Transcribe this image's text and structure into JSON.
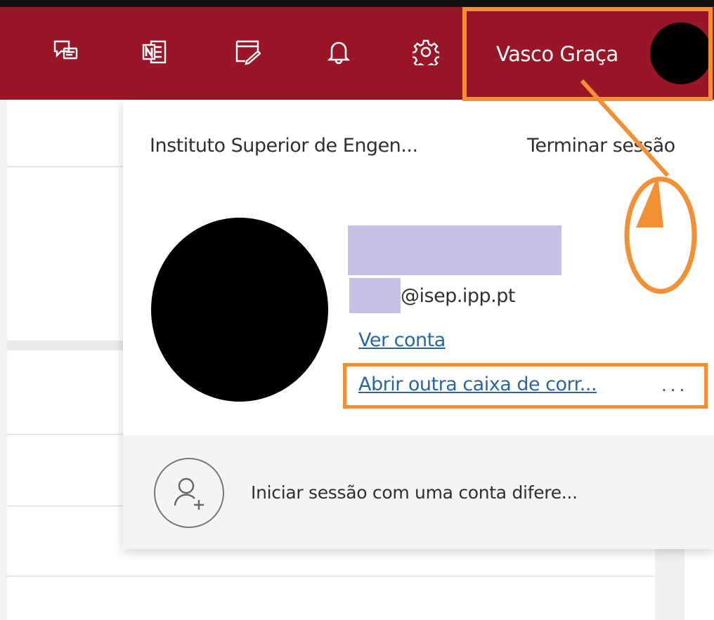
{
  "header": {
    "icons": [
      "feedback-icon",
      "onenote-icon",
      "tasks-icon",
      "notification-bell-icon",
      "settings-gear-icon"
    ],
    "user_name": "Vasco Graça"
  },
  "account_menu": {
    "organization": "Instituto Superior de Engen...",
    "sign_out": "Terminar sessão",
    "email_suffix": "@isep.ipp.pt",
    "view_account": "Ver conta",
    "open_other_mailbox": "Abrir outra caixa de corr...",
    "more_options": "...",
    "sign_in_other": "Iniciar sessão com uma conta difere..."
  },
  "colors": {
    "header_bg": "#981627",
    "link": "#2867a7",
    "annotation": "#f39035",
    "redaction": "#c8c0e4"
  }
}
